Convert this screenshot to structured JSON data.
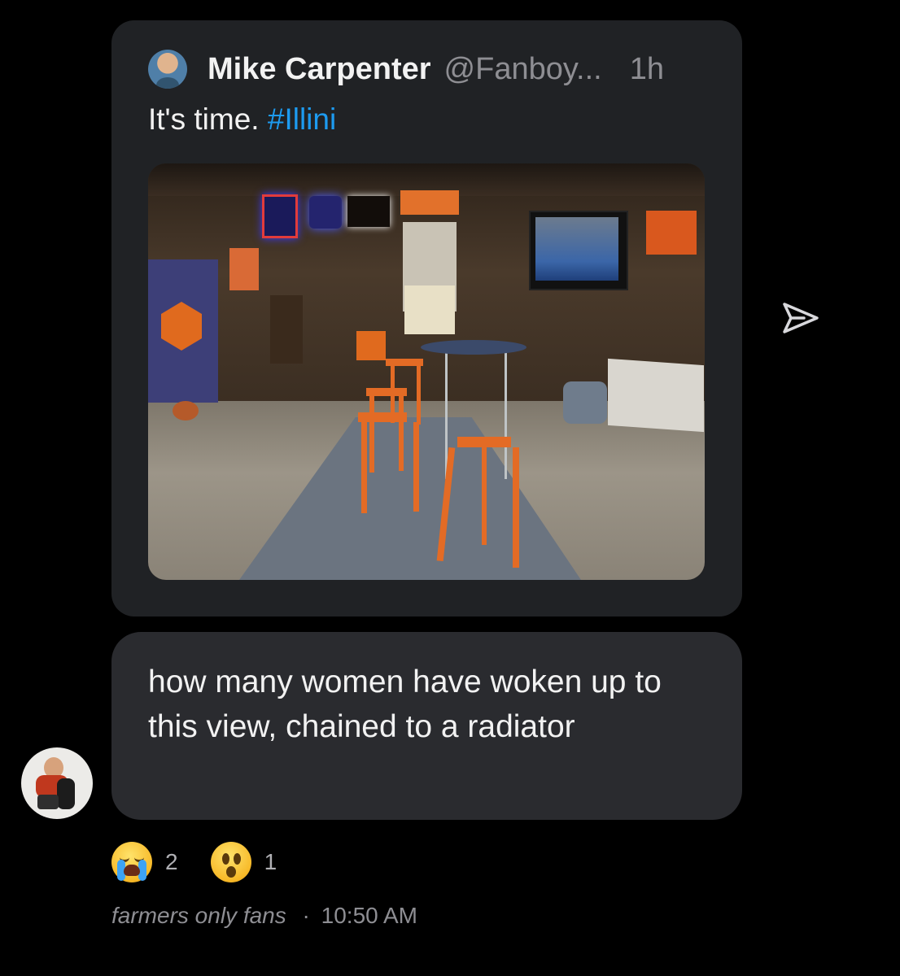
{
  "quoted_post": {
    "author_name": "Mike Carpenter",
    "author_handle": "@Fanboy...",
    "time": "1h",
    "text": "It's time.",
    "hashtag": "#Illini"
  },
  "message": {
    "text": "how many women have woken up to this view, chained to a radiator"
  },
  "reactions": [
    {
      "icon": "crying-face-emoji",
      "count": "2"
    },
    {
      "icon": "astonished-face-emoji",
      "count": "1"
    }
  ],
  "footer": {
    "sender": "farmers only fans",
    "separator": "·",
    "timestamp": "10:50 AM"
  },
  "colors": {
    "background": "#000000",
    "bubble": "#2a2b2f",
    "quoted_bubble": "#202225",
    "hashtag": "#1d9bf0",
    "muted_text": "#8e8e93"
  }
}
